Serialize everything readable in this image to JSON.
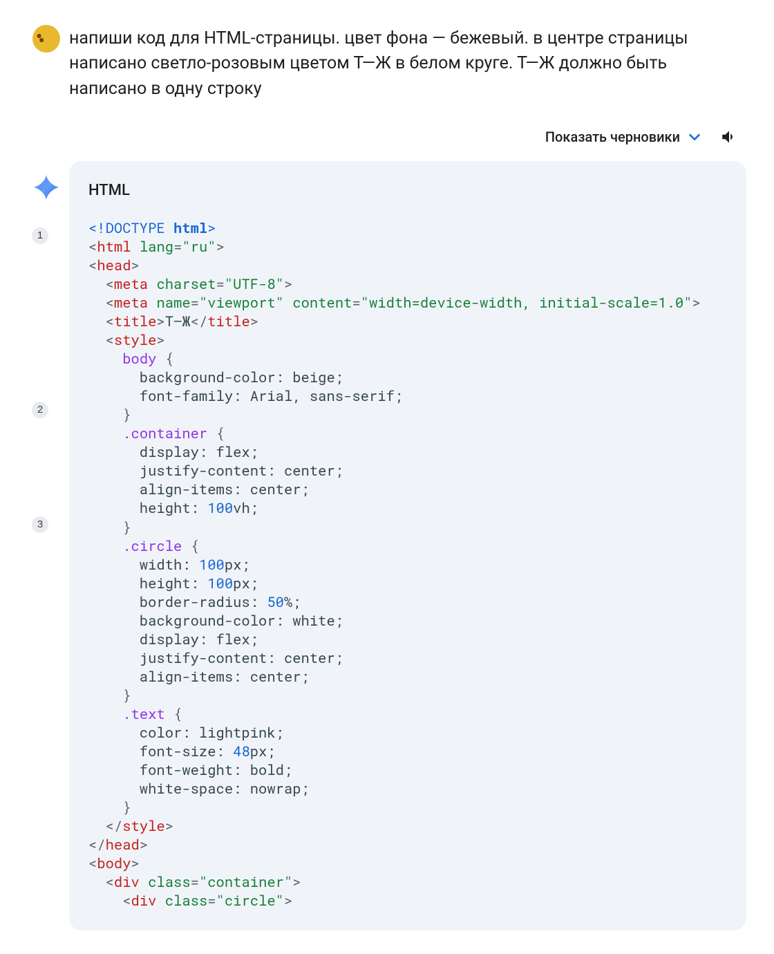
{
  "user_prompt": "напиши код для HTML-страницы. цвет фона — бежевый. в центре страницы написано светло-розовым цветом Т—Ж в белом круге. Т—Ж должно быть написано в одну строку",
  "drafts_label": "Показать черновики",
  "code_title": "HTML",
  "citations": [
    "1",
    "2",
    "3"
  ],
  "code_lines": {
    "l1_a": "<!DOCTYPE ",
    "l1_b": "html",
    "l1_c": ">",
    "l2_a": "<",
    "l2_b": "html",
    "l2_c": " ",
    "l2_d": "lang",
    "l2_e": "=",
    "l2_f": "\"ru\"",
    "l2_g": ">",
    "l3_a": "<",
    "l3_b": "head",
    "l3_c": ">",
    "l4_a": "  <",
    "l4_b": "meta",
    "l4_c": " ",
    "l4_d": "charset",
    "l4_e": "=",
    "l4_f": "\"UTF-8\"",
    "l4_g": ">",
    "l5_a": "  <",
    "l5_b": "meta",
    "l5_c": " ",
    "l5_d": "name",
    "l5_e": "=",
    "l5_f": "\"viewport\"",
    "l5_g": " ",
    "l5_h": "content",
    "l5_i": "=",
    "l5_j": "\"width=device-width, initial-scale=1.0\"",
    "l5_k": ">",
    "l6_a": "  <",
    "l6_b": "title",
    "l6_c": ">",
    "l6_d": "Т—Ж",
    "l6_e": "</",
    "l6_f": "title",
    "l6_g": ">",
    "l7_a": "  <",
    "l7_b": "style",
    "l7_c": ">",
    "l8_a": "    ",
    "l8_b": "body",
    "l8_c": " {",
    "l9": "      background-color: beige;",
    "l10": "      font-family: Arial, sans-serif;",
    "l11": "    }",
    "l12_a": "    ",
    "l12_b": ".container",
    "l12_c": " {",
    "l13": "      display: flex;",
    "l14": "      justify-content: center;",
    "l15": "      align-items: center;",
    "l16_a": "      height: ",
    "l16_b": "100",
    "l16_c": "vh;",
    "l17": "    }",
    "l18_a": "    ",
    "l18_b": ".circle",
    "l18_c": " {",
    "l19_a": "      width: ",
    "l19_b": "100",
    "l19_c": "px;",
    "l20_a": "      height: ",
    "l20_b": "100",
    "l20_c": "px;",
    "l21_a": "      border-radius: ",
    "l21_b": "50",
    "l21_c": "%;",
    "l22": "      background-color: white;",
    "l23": "      display: flex;",
    "l24": "      justify-content: center;",
    "l25": "      align-items: center;",
    "l26": "    }",
    "l27_a": "    ",
    "l27_b": ".text",
    "l27_c": " {",
    "l28": "      color: lightpink;",
    "l29_a": "      font-size: ",
    "l29_b": "48",
    "l29_c": "px;",
    "l30": "      font-weight: bold;",
    "l31": "      white-space: nowrap;",
    "l32": "    }",
    "l33_a": "  </",
    "l33_b": "style",
    "l33_c": ">",
    "l34_a": "</",
    "l34_b": "head",
    "l34_c": ">",
    "l35_a": "<",
    "l35_b": "body",
    "l35_c": ">",
    "l36_a": "  <",
    "l36_b": "div",
    "l36_c": " ",
    "l36_d": "class",
    "l36_e": "=",
    "l36_f": "\"container\"",
    "l36_g": ">",
    "l37_a": "    <",
    "l37_b": "div",
    "l37_c": " ",
    "l37_d": "class",
    "l37_e": "=",
    "l37_f": "\"circle\"",
    "l37_g": ">"
  }
}
